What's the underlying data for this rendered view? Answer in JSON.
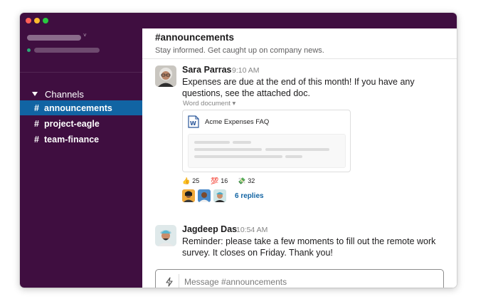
{
  "sidebar": {
    "section_label": "Channels",
    "channels": [
      {
        "hash": "#",
        "name": "announcements",
        "active": true
      },
      {
        "hash": "#",
        "name": "project-eagle",
        "active": false
      },
      {
        "hash": "#",
        "name": "team-finance",
        "active": false
      }
    ]
  },
  "channel": {
    "title": "#announcements",
    "topic": "Stay informed. Get caught up on company news."
  },
  "messages": [
    {
      "author": "Sara Parras",
      "time": "9:10 AM",
      "text": "Expenses are due at the end of this month! If you have any questions, see the attached doc.",
      "attachment": {
        "type_label": "Word document ▾",
        "title": "Acme Expenses FAQ",
        "icon": "word-doc-icon"
      },
      "reactions": [
        {
          "emoji": "👍",
          "count": "25"
        },
        {
          "emoji": "💯",
          "count": "16"
        },
        {
          "emoji": "💸",
          "count": "32"
        }
      ],
      "replies_label": "6 replies"
    },
    {
      "author": "Jagdeep Das",
      "time": "10:54 AM",
      "text": "Reminder: please take a few moments to fill out the remote work survey. It closes on Friday. Thank you!"
    }
  ],
  "composer": {
    "placeholder": "Message #announcements",
    "icon": "lightning-bolt-icon"
  },
  "colors": {
    "sidebar": "#3f0e40",
    "active_channel": "#1164a3",
    "link": "#1264a3"
  }
}
